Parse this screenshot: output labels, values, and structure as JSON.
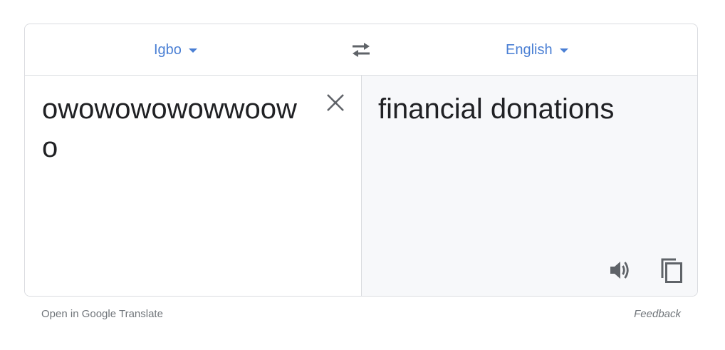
{
  "languages": {
    "source": "Igbo",
    "target": "English"
  },
  "source": {
    "text": "owowowowowwoowo"
  },
  "translation": {
    "text": "financial donations"
  },
  "footer": {
    "open_link": "Open in Google Translate",
    "feedback": "Feedback"
  },
  "icons": {
    "swap": "swap-arrows-icon",
    "clear": "close-icon",
    "speak": "speaker-icon",
    "copy": "copy-icon",
    "dropdown": "caret-down-icon"
  },
  "colors": {
    "accent": "#4a7fd4",
    "icon": "#5f6368",
    "text": "#202124",
    "border": "#dadce0",
    "target_background": "#f7f8fa"
  }
}
